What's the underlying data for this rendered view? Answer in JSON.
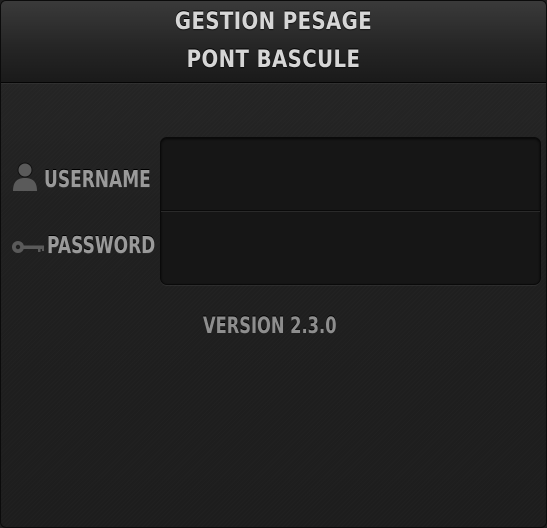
{
  "header": {
    "title_line1": "GESTION PESAGE",
    "title_line2": "PONT BASCULE"
  },
  "login": {
    "username_label": "USERNAME",
    "password_label": "PASSWORD",
    "username_icon": "user-icon",
    "password_icon": "key-icon",
    "username_value": "",
    "password_value": ""
  },
  "footer": {
    "version": "VERSION 2.3.0"
  },
  "colors": {
    "background": "#1f1f1f",
    "header": "#2a2a2a",
    "title_text": "#d6d6d6",
    "label_text": "#9a9a9a",
    "field_background": "#161616"
  }
}
